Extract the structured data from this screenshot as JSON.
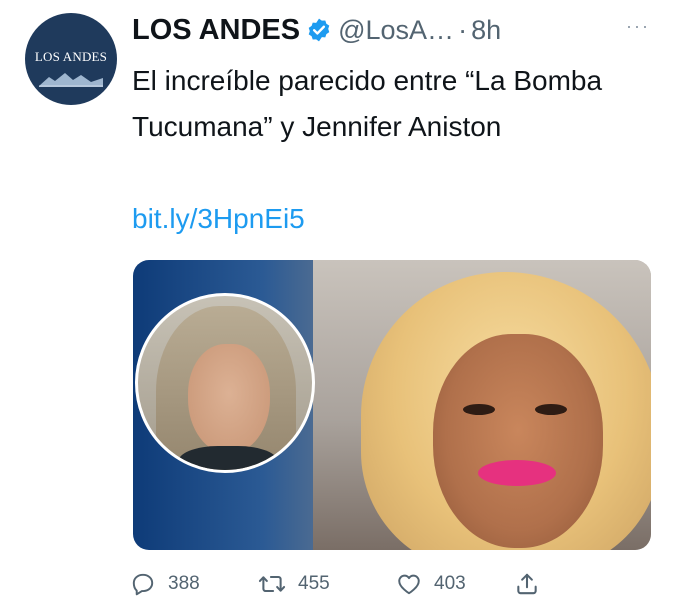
{
  "avatar": {
    "logo_text": "LOS ANDES"
  },
  "tweet": {
    "display_name": "LOS ANDES",
    "handle": "@LosA…",
    "separator": "·",
    "time": "8h",
    "more": "···",
    "text": "El increíble parecido entre “La Bomba Tucumana” y Jennifer Aniston",
    "link": "bit.ly/3HpnEi5"
  },
  "actions": {
    "replies": "388",
    "retweets": "455",
    "likes": "403"
  },
  "icons": {
    "verified": "verified-badge-icon",
    "reply": "reply-icon",
    "retweet": "retweet-icon",
    "like": "heart-icon",
    "share": "share-icon"
  },
  "colors": {
    "link": "#1d9bf0",
    "secondary_text": "#536471",
    "avatar_bg": "#1f3a5c",
    "verified": "#1d9bf0"
  }
}
